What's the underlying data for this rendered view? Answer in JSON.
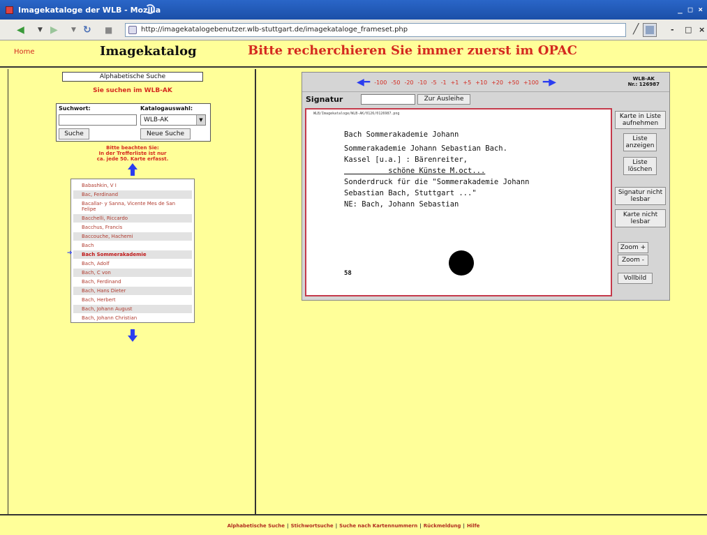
{
  "window": {
    "title": "Imagekataloge der WLB - Mozilla",
    "buttons": [
      "_",
      "□",
      "×"
    ]
  },
  "navbar": {
    "url": "http://imagekatalogebenutzer.wlb-stuttgart.de/imagekataloge_frameset.php",
    "mini_buttons": [
      "-",
      "□",
      "×"
    ]
  },
  "header": {
    "home": "Home",
    "title": "Imagekatalog",
    "hint": "Bitte recherchieren Sie immer zuerst im OPAC"
  },
  "left": {
    "alpha_title": "Alphabetische Suche",
    "subtitle": "Sie suchen im WLB-AK",
    "search_label": "Suchwort:",
    "catalog_label": "Katalogauswahl:",
    "search_value": "",
    "catalog_value": "WLB-AK",
    "search_button": "Suche",
    "new_search_button": "Neue Suche",
    "notice": [
      "Bitte beachten Sie:",
      "In der Trefferliste ist nur",
      "ca. jede 50. Karte erfasst."
    ],
    "names": [
      {
        "text": "Babashkin, V I",
        "alt": false,
        "selected": false
      },
      {
        "text": "Bac, Ferdinand",
        "alt": true,
        "selected": false
      },
      {
        "text": "Bacallar- y Sanna, Vicente Mes de San Felipe",
        "alt": false,
        "selected": false
      },
      {
        "text": "Bacchelli, Riccardo",
        "alt": true,
        "selected": false
      },
      {
        "text": "Bacchus, Francis",
        "alt": false,
        "selected": false
      },
      {
        "text": "Baccouche, Hachemi",
        "alt": true,
        "selected": false
      },
      {
        "text": "Bach",
        "alt": false,
        "selected": false
      },
      {
        "text": "Bach Sommerakademie",
        "alt": true,
        "selected": true
      },
      {
        "text": "Bach, Adolf",
        "alt": false,
        "selected": false
      },
      {
        "text": "Bach, C von",
        "alt": true,
        "selected": false
      },
      {
        "text": "Bach, Ferdinand",
        "alt": false,
        "selected": false
      },
      {
        "text": "Bach, Hans Dieter",
        "alt": true,
        "selected": false
      },
      {
        "text": "Bach, Herbert",
        "alt": false,
        "selected": false
      },
      {
        "text": "Bach, Johann August",
        "alt": true,
        "selected": false
      },
      {
        "text": "Bach, Johann Christian",
        "alt": false,
        "selected": false
      }
    ]
  },
  "viewer": {
    "pager": [
      "-100",
      "-50",
      "-20",
      "-10",
      "-5",
      "-1",
      "+1",
      "+5",
      "+10",
      "+20",
      "+50",
      "+100"
    ],
    "catalog": "WLB-AK",
    "number": "Nr.: 126987",
    "sig_label": "Signatur",
    "sig_value": "",
    "ausleihe_button": "Zur Ausleihe",
    "card": {
      "path": "WLB/Imagekataloge/WLB-AK/0126/0126987.png",
      "lines": [
        "Bach Sommerakademie Johann",
        "Sommerakademie Johann Sebastian Bach.",
        "Kassel [u.a.] : Bärenreiter,",
        "          schöne Künste M.oct...",
        "Sonderdruck für die \"Sommerakademie Johann",
        "Sebastian Bach, Stuttgart ...\"",
        "NE: Bach, Johann Sebastian"
      ],
      "stamp": "58"
    },
    "side_buttons": {
      "add_list": "Karte in Liste aufnehmen",
      "show_list": "Liste anzeigen",
      "delete_list": "Liste löschen",
      "sig_unreadable": "Signatur nicht lesbar",
      "card_unreadable": "Karte nicht lesbar",
      "zoom_in": "Zoom +",
      "zoom_out": "Zoom -",
      "fullscreen": "Vollbild"
    }
  },
  "footer": {
    "links": [
      "Alphabetische Suche",
      "Stichwortsuche",
      "Suche nach Kartennummern",
      "Rückmeldung",
      "Hilfe"
    ]
  }
}
